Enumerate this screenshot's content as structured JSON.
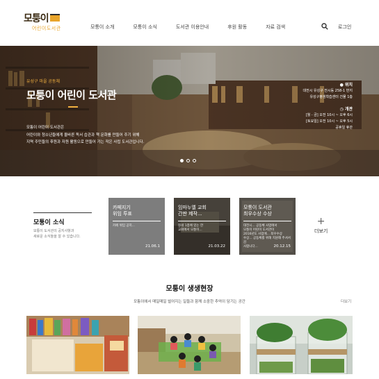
{
  "header": {
    "logo": {
      "main": "모퉁이",
      "sub": "어린이도서관"
    },
    "nav": [
      "모퉁이 소개",
      "모퉁이 소식",
      "도서관 이용안내",
      "후원 활동",
      "자료 검색"
    ],
    "login": "로그인",
    "search_icon": "search-icon"
  },
  "hero": {
    "subtitle": "유성구 마을 공동체",
    "title": "모퉁이 어린이 도서관",
    "description": [
      "모퉁이 어린이 도서관은",
      "어린이와 청소년들에게 올바른 독서 습관과 책 문화를 만들어 주기 위해",
      "지역 주민들의 후원과 자원 활동으로 만들어 가는 작은 사립 도서관입니다."
    ],
    "location_label": "위치",
    "location_lines": [
      "대전시 유성구 전시동 258-1 번지",
      "유성구평생학습센터 건물 1층"
    ],
    "hours_label": "개관",
    "hours_lines": [
      "[월 - 금] 오전 10시 ~ 오후 6시",
      "[토요일] 오전 10시 ~ 오후 5시",
      "공휴일 휴관"
    ],
    "slides": 3,
    "active_slide": 1,
    "accent": "#f0b040"
  },
  "news": {
    "title": "모퉁이 소식",
    "description": [
      "모퉁이 도서관의 공지사항과",
      "새로운 소식들을 알 수 있습니다."
    ],
    "cards": [
      {
        "title": [
          "카페지기",
          "위임 투표"
        ],
        "excerpt": [
          "카페 위임 공지..."
        ],
        "date": "21.06.1"
      },
      {
        "title": [
          "임마누엘 교회",
          "간판 제작..."
        ],
        "excerpt": [
          "동네 1층에 있는 한",
          "교회에서 모퉁이..."
        ],
        "date": "21.03.22"
      },
      {
        "title": [
          "모퉁이 도서관",
          "최우수상 수상"
        ],
        "excerpt": [
          "대전시... 공동체 사업에서",
          "모퉁이 어린이 도서관이",
          "2016년도 사업에... 최우수상",
          "수상... 공동체를 위해 지원해 주셔서 감",
          "사합니다..."
        ],
        "date": "20.12.15"
      }
    ],
    "more_plus": "+",
    "more_label": "더보기"
  },
  "life": {
    "title": "모퉁이 생생현장",
    "subtitle": "모퉁이에서 매일매일 벌어지는 일들과 함께 소중한 추억이 담기는 공간",
    "more_label": "더보기",
    "photos": [
      "bookshelf-photo",
      "children-reading-photo",
      "plant-jars-photo"
    ]
  }
}
